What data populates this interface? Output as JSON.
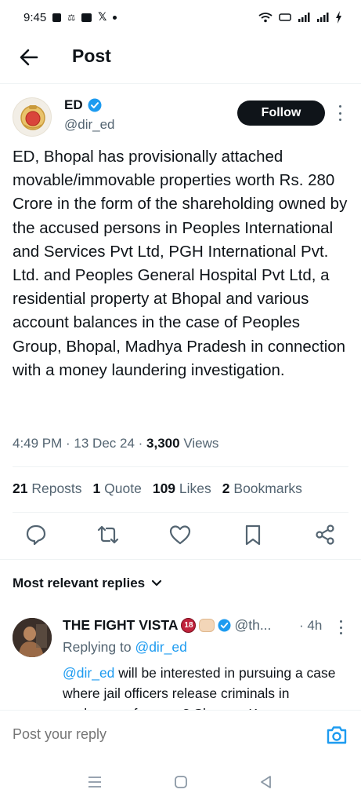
{
  "statusbar": {
    "time": "9:45"
  },
  "header": {
    "title": "Post"
  },
  "post": {
    "name": "ED",
    "handle": "@dir_ed",
    "follow_label": "Follow",
    "text": "ED, Bhopal has provisionally attached movable/immovable properties worth Rs. 280 Crore in the form of the shareholding owned by the accused persons in Peoples International and Services Pvt Ltd, PGH International Pvt. Ltd. and Peoples General Hospital Pvt Ltd, a residential property at Bhopal and various account balances in the case of Peoples Group, Bhopal, Madhya Pradesh in connection with a money laundering investigation.",
    "time": "4:49 PM",
    "date": "13 Dec 24",
    "views_count": "3,300",
    "views_label": "Views",
    "reposts_count": "21",
    "reposts_label": "Reposts",
    "quotes_count": "1",
    "quotes_label": "Quote",
    "likes_count": "109",
    "likes_label": "Likes",
    "bookmarks_count": "2",
    "bookmarks_label": "Bookmarks"
  },
  "replies": {
    "heading": "Most relevant replies",
    "items": [
      {
        "name": "THE FIGHT VISTA",
        "badge": "18",
        "handle": "@th...",
        "time": "· 4h",
        "replying_prefix": "Replying to",
        "replying_to": "@dir_ed",
        "mention": "@dir_ed",
        "text": " will be interested in pursuing a case where jail officers release criminals in exchange of money? Shravan Kumar"
      }
    ]
  },
  "composer": {
    "placeholder": "Post your reply"
  },
  "colors": {
    "accent": "#1d9bf0",
    "text": "#0f1419",
    "secondary": "#536471",
    "divider": "#eff3f4"
  }
}
